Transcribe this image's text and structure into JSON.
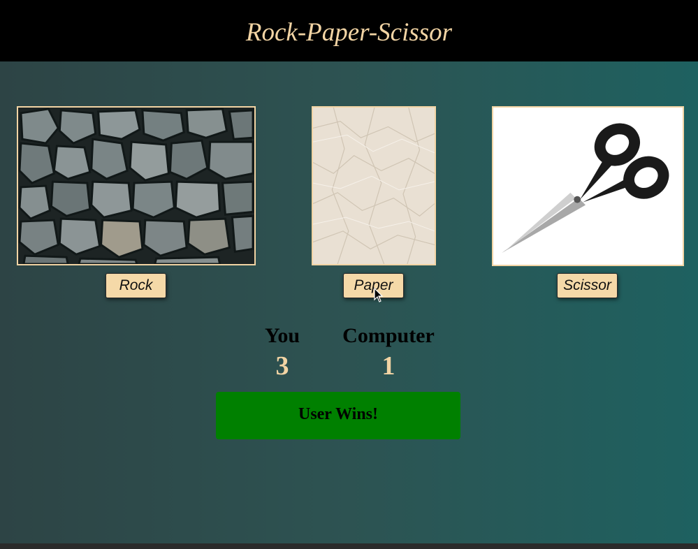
{
  "header": {
    "title": "Rock-Paper-Scissor"
  },
  "choices": [
    {
      "id": "rock",
      "label": "Rock",
      "image": "rock-wall-image"
    },
    {
      "id": "paper",
      "label": "Paper",
      "image": "crumpled-paper-image"
    },
    {
      "id": "scissor",
      "label": "Scissor",
      "image": "scissors-image"
    }
  ],
  "scoreboard": {
    "user_label": "You",
    "user_score": "3",
    "computer_label": "Computer",
    "computer_score": "1"
  },
  "result": {
    "message": "User Wins!",
    "color": "#008000"
  },
  "colors": {
    "accent": "#f2d4a4",
    "header_bg": "#000000",
    "button_bg": "#f5d9a8"
  }
}
